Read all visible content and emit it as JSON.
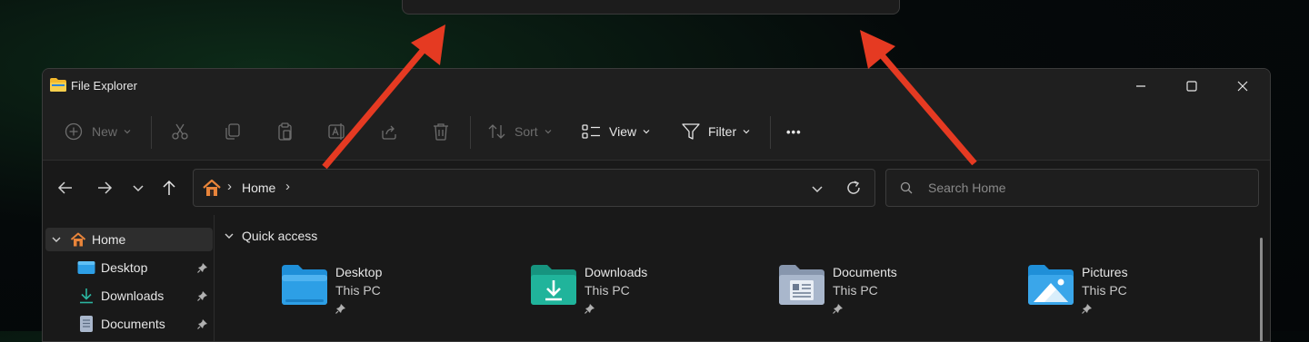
{
  "window": {
    "title": "File Explorer"
  },
  "toolbar": {
    "new_label": "New",
    "sort_label": "Sort",
    "view_label": "View",
    "filter_label": "Filter",
    "more_label": "•••"
  },
  "address": {
    "segment": "Home",
    "separator": "›"
  },
  "search": {
    "placeholder": "Search Home"
  },
  "sidebar": {
    "items": [
      {
        "label": "Home",
        "icon": "home-icon",
        "pinned": false
      },
      {
        "label": "Desktop",
        "icon": "desktop-folder-icon",
        "pinned": true
      },
      {
        "label": "Downloads",
        "icon": "download-icon",
        "pinned": true
      },
      {
        "label": "Documents",
        "icon": "documents-icon",
        "pinned": true
      }
    ]
  },
  "main": {
    "section_title": "Quick access",
    "tiles": [
      {
        "name": "Desktop",
        "location": "This PC",
        "icon": "desktop-folder-icon"
      },
      {
        "name": "Downloads",
        "location": "This PC",
        "icon": "downloads-folder-icon"
      },
      {
        "name": "Documents",
        "location": "This PC",
        "icon": "documents-folder-icon"
      },
      {
        "name": "Pictures",
        "location": "This PC",
        "icon": "pictures-folder-icon"
      }
    ]
  },
  "colors": {
    "annotation_arrow": "#e53a22",
    "folder_desktop": "#2d9fe6",
    "folder_downloads": "#20b49b",
    "folder_documents": "#a9b7cc",
    "folder_pictures": "#3aa6ea",
    "home_icon": "#e8843a"
  }
}
